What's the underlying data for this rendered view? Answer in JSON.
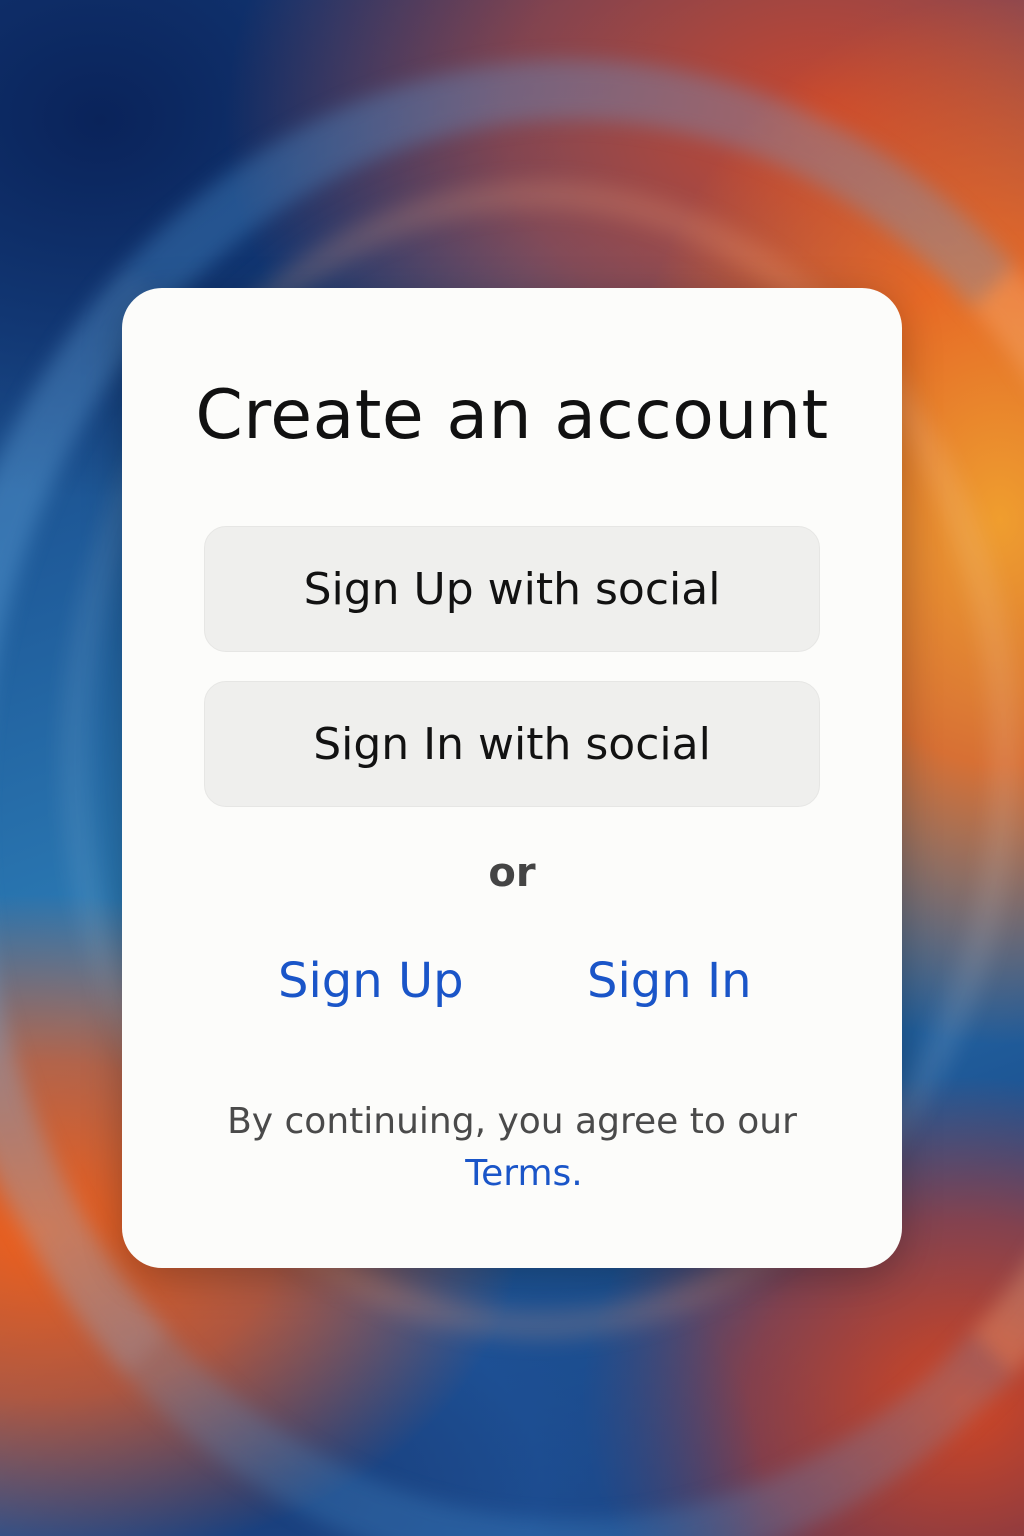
{
  "dialog": {
    "title": "Create an account",
    "social_signup_label": "Sign Up with social",
    "social_signin_label": "Sign In with social",
    "separator": "or",
    "signup_link": "Sign Up",
    "signin_link": "Sign In",
    "legal_text": "By continuing, you agree to our",
    "terms_link": "Terms."
  },
  "colors": {
    "card_background": "#fcfcfa",
    "button_background": "#efefed",
    "link": "#1a55c8",
    "title": "#111111"
  }
}
